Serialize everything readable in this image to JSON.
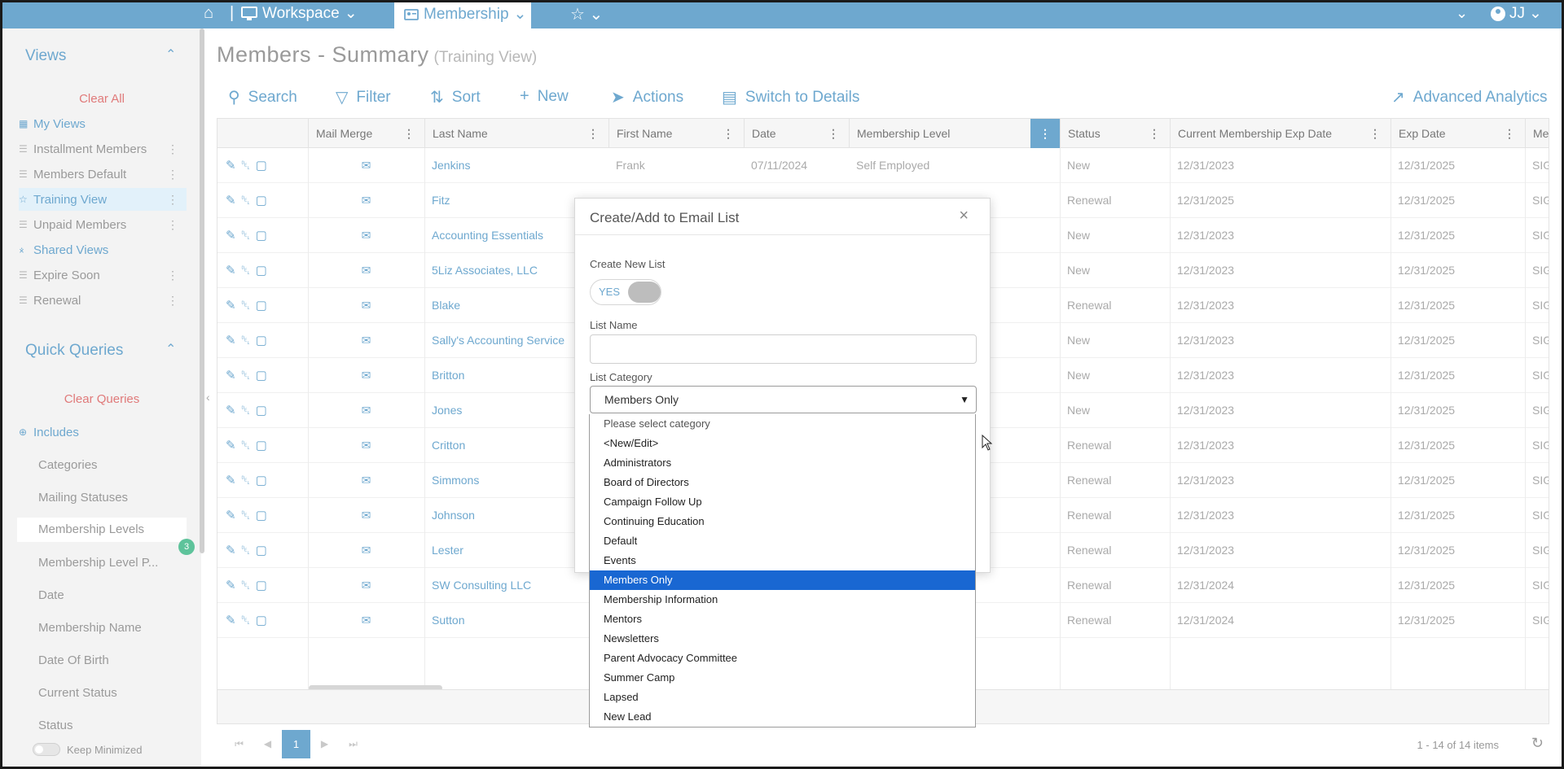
{
  "topbar": {
    "workspace_label": "Workspace",
    "module_label": "Membership",
    "user_initials": "JJ"
  },
  "sidebar": {
    "views_heading": "Views",
    "clear_all": "Clear All",
    "views": [
      {
        "label": "My Views"
      },
      {
        "label": "Installment Members"
      },
      {
        "label": "Members Default"
      },
      {
        "label": "Training View"
      },
      {
        "label": "Unpaid Members"
      },
      {
        "label": "Shared Views"
      },
      {
        "label": "Expire Soon"
      },
      {
        "label": "Renewal"
      }
    ],
    "quick_heading": "Quick Queries",
    "clear_queries": "Clear Queries",
    "includes": "Includes",
    "queries": [
      {
        "label": "Categories"
      },
      {
        "label": "Mailing Statuses"
      },
      {
        "label": "Membership Levels"
      },
      {
        "label": "Membership Level P..."
      },
      {
        "label": "Date"
      },
      {
        "label": "Membership Name"
      },
      {
        "label": "Date Of Birth"
      },
      {
        "label": "Current Status"
      },
      {
        "label": "Status"
      }
    ],
    "membership_levels_badge": "3",
    "keep_minimized": "Keep Minimized"
  },
  "page": {
    "title": "Members - Summary",
    "subtitle": "(Training View)"
  },
  "toolbar": {
    "search": "Search",
    "filter": "Filter",
    "sort": "Sort",
    "new": "New",
    "actions": "Actions",
    "switch": "Switch to Details",
    "analytics": "Advanced Analytics"
  },
  "grid": {
    "columns": [
      "Mail Merge",
      "Last Name",
      "First Name",
      "Date",
      "Membership Level",
      "Status",
      "Current Membership Exp Date",
      "Exp Date",
      "Mer"
    ],
    "rows": [
      {
        "last": "Jenkins",
        "first": "Frank",
        "date": "07/11/2024",
        "level": "Self Employed",
        "status": "New",
        "cur_exp": "12/31/2023",
        "exp": "12/31/2025",
        "mer": "SIGI"
      },
      {
        "last": "Fitz",
        "first": "",
        "date": "",
        "level": "",
        "status": "Renewal",
        "cur_exp": "12/31/2025",
        "exp": "12/31/2025",
        "mer": "SIGI"
      },
      {
        "last": "Accounting Essentials",
        "first": "",
        "date": "",
        "level": "",
        "status": "New",
        "cur_exp": "12/31/2023",
        "exp": "12/31/2025",
        "mer": "SIGI"
      },
      {
        "last": "5Liz Associates, LLC",
        "first": "",
        "date": "",
        "level": "",
        "status": "New",
        "cur_exp": "12/31/2023",
        "exp": "12/31/2025",
        "mer": "SIGI"
      },
      {
        "last": "Blake",
        "first": "",
        "date": "",
        "level": "",
        "status": "Renewal",
        "cur_exp": "12/31/2023",
        "exp": "12/31/2025",
        "mer": "SIGI"
      },
      {
        "last": "Sally's Accounting Service",
        "first": "",
        "date": "",
        "level": "",
        "status": "New",
        "cur_exp": "12/31/2023",
        "exp": "12/31/2025",
        "mer": "SIGI"
      },
      {
        "last": "Britton",
        "first": "",
        "date": "",
        "level": "",
        "status": "New",
        "cur_exp": "12/31/2023",
        "exp": "12/31/2025",
        "mer": "SIGI"
      },
      {
        "last": "Jones",
        "first": "",
        "date": "",
        "level": "",
        "status": "New",
        "cur_exp": "12/31/2023",
        "exp": "12/31/2025",
        "mer": "SIGI"
      },
      {
        "last": "Critton",
        "first": "",
        "date": "",
        "level": "",
        "status": "Renewal",
        "cur_exp": "12/31/2023",
        "exp": "12/31/2025",
        "mer": "SIGI"
      },
      {
        "last": "Simmons",
        "first": "",
        "date": "",
        "level": "",
        "status": "Renewal",
        "cur_exp": "12/31/2023",
        "exp": "12/31/2025",
        "mer": "SIGI"
      },
      {
        "last": "Johnson",
        "first": "",
        "date": "",
        "level": "",
        "status": "Renewal",
        "cur_exp": "12/31/2023",
        "exp": "12/31/2025",
        "mer": "SIGI"
      },
      {
        "last": "Lester",
        "first": "",
        "date": "",
        "level": "",
        "status": "Renewal",
        "cur_exp": "12/31/2023",
        "exp": "12/31/2025",
        "mer": "SIGI"
      },
      {
        "last": "SW Consulting LLC",
        "first": "",
        "date": "",
        "level": "",
        "status": "Renewal",
        "cur_exp": "12/31/2024",
        "exp": "12/31/2025",
        "mer": "SIGI"
      },
      {
        "last": "Sutton",
        "first": "",
        "date": "",
        "level": "",
        "status": "Renewal",
        "cur_exp": "12/31/2024",
        "exp": "12/31/2025",
        "mer": "SIGI"
      }
    ],
    "current_page": "1",
    "items_summary": "1 - 14 of 14 items"
  },
  "modal": {
    "title": "Create/Add to Email List",
    "create_new_label": "Create New List",
    "toggle_value": "YES",
    "list_name_label": "List Name",
    "list_name_value": "",
    "list_category_label": "List Category",
    "list_category_value": "Members Only",
    "options": [
      "Please select category",
      "<New/Edit>",
      "Administrators",
      "Board of Directors",
      "Campaign Follow Up",
      "Continuing Education",
      "Default",
      "Events",
      "Members Only",
      "Membership Information",
      "Mentors",
      "Newsletters",
      "Parent Advocacy Committee",
      "Summer Camp",
      "Lapsed",
      "New Lead"
    ],
    "selected_option": "Members Only"
  },
  "colors": {
    "brand": "#6ea8cf",
    "selected_option": "#1967d2",
    "clear_link": "#e07a7a",
    "badge": "#5ec39b"
  },
  "icons": [
    "home-icon",
    "monitor-icon",
    "chevron-down-icon",
    "id-card-icon",
    "star-icon",
    "user-circle-icon",
    "search-icon",
    "filter-icon",
    "sort-icon",
    "plus-icon",
    "rocket-icon",
    "switch-icon",
    "chart-icon",
    "kebab-icon",
    "edit-icon",
    "trash-icon",
    "note-icon",
    "mail-icon",
    "close-icon",
    "refresh-icon"
  ]
}
